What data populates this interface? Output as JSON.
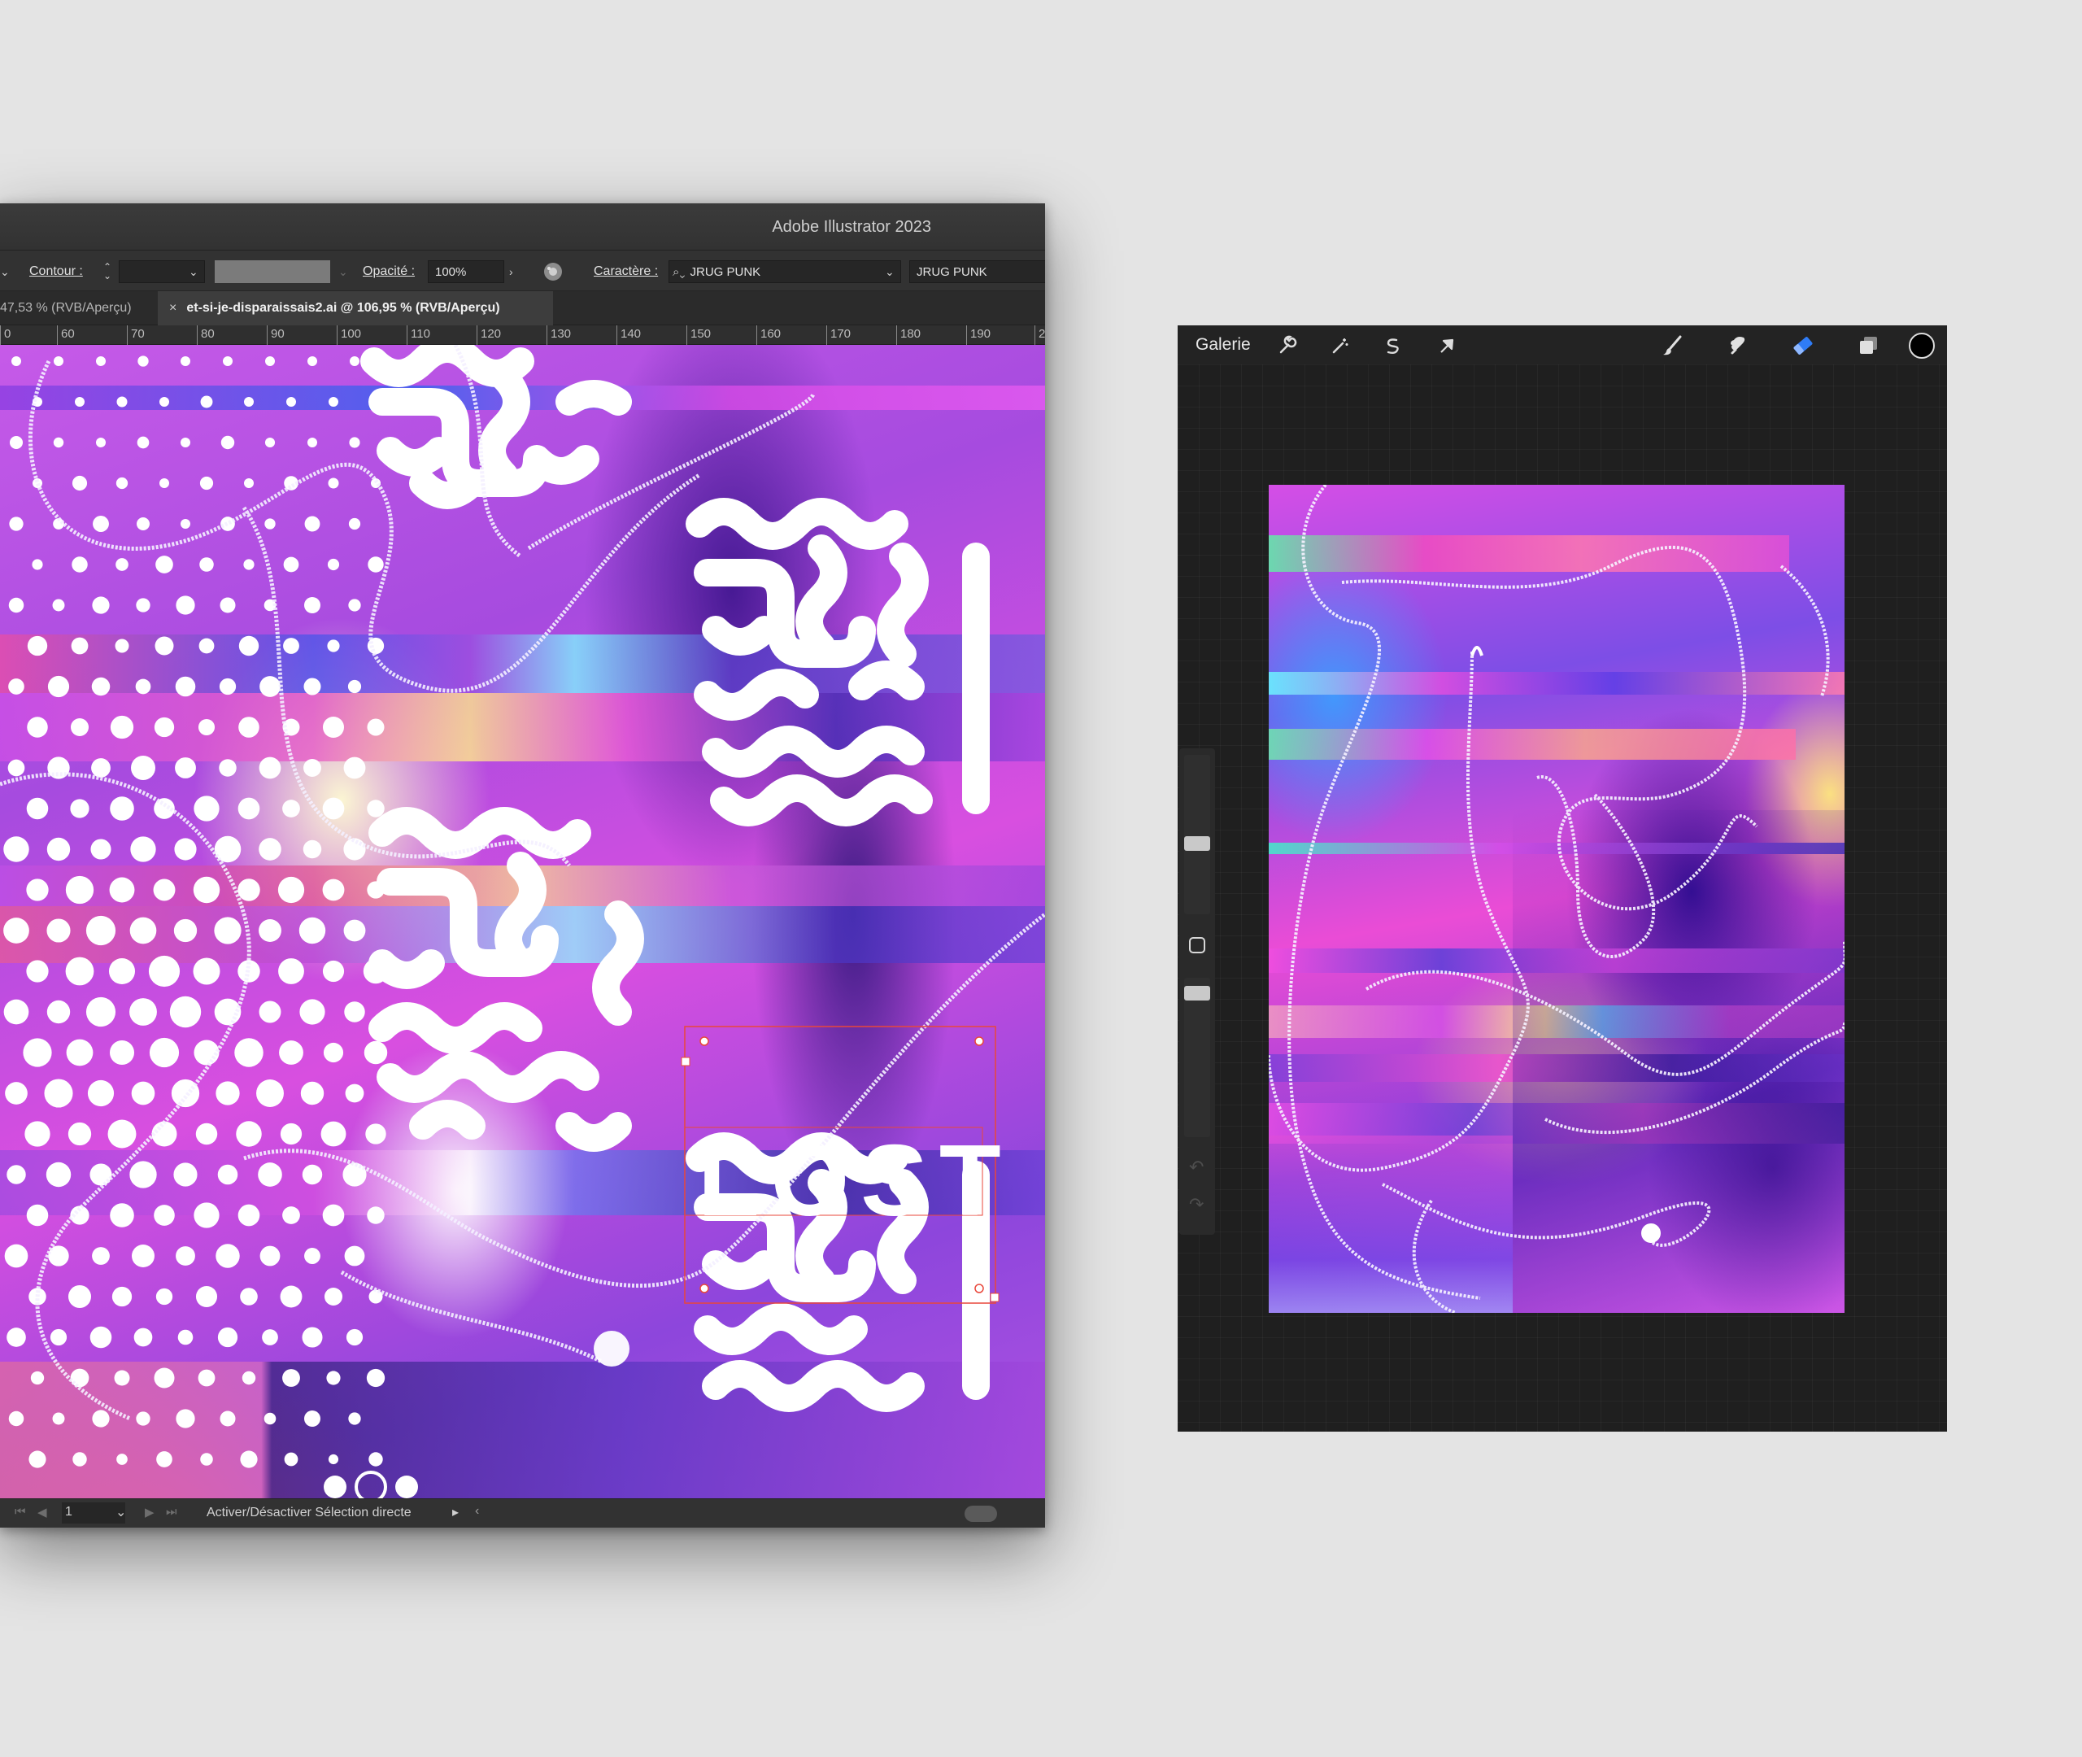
{
  "illustrator": {
    "window_title": "Adobe Illustrator 2023",
    "control_bar": {
      "contour_label": "Contour :",
      "opacity_label": "Opacité :",
      "opacity_value": "100%",
      "character_label": "Caractère :",
      "font_family": "JRUG PUNK",
      "font_style": "JRUG PUNK"
    },
    "tabs": [
      {
        "label": "47,53 % (RVB/Aperçu)",
        "active": false
      },
      {
        "label": "et-si-je-disparaissais2.ai @ 106,95 % (RVB/Aperçu)",
        "active": true
      }
    ],
    "tab_close_glyph": "×",
    "ruler_ticks": [
      "0",
      "60",
      "70",
      "80",
      "90",
      "100",
      "110",
      "120",
      "130",
      "140",
      "150",
      "160",
      "170",
      "180",
      "190",
      "2"
    ],
    "canvas_text": "LOST",
    "status_bar": {
      "page_number": "1",
      "status_text": "Activer/Désactiver Sélection directe"
    }
  },
  "procreate": {
    "gallery_label": "Galerie",
    "tools_left": [
      "wrench-icon",
      "magic-wand-icon",
      "selection-icon",
      "transform-arrow-icon"
    ],
    "tools_right": [
      "brush-icon",
      "smudge-icon",
      "eraser-icon",
      "layers-icon",
      "color-icon"
    ],
    "active_tool": "eraser-icon",
    "accent_color": "#2f7cf6",
    "current_color": "#000000"
  }
}
